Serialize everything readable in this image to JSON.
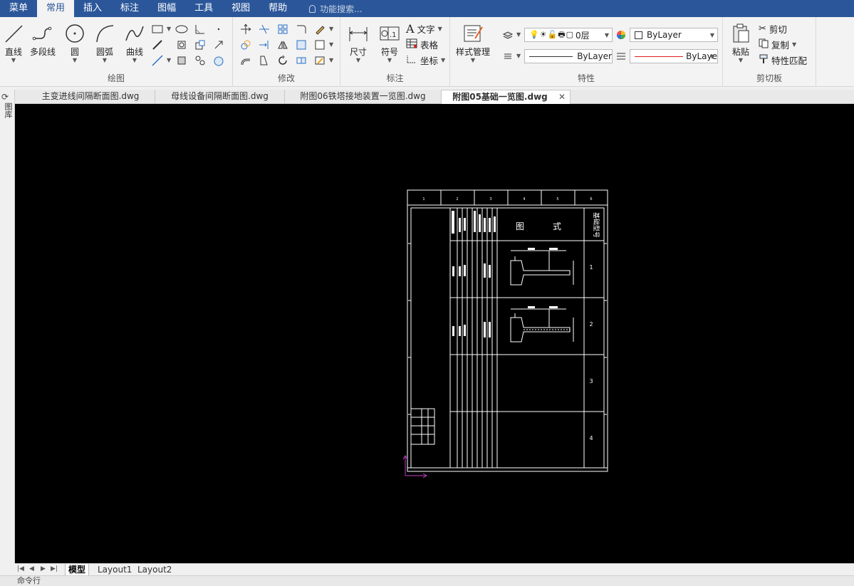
{
  "menu": {
    "items": [
      "菜单",
      "常用",
      "插入",
      "标注",
      "图幅",
      "工具",
      "视图",
      "帮助"
    ],
    "active_index": 1,
    "search_placeholder": "功能搜索..."
  },
  "ribbon": {
    "draw": {
      "label": "绘图",
      "line": "直线",
      "polyline": "多段线",
      "circle": "圆",
      "arc": "圆弧",
      "spline": "曲线"
    },
    "modify": {
      "label": "修改"
    },
    "annotate": {
      "label": "标注",
      "dimension": "尺寸",
      "symbol": "符号",
      "text": "文字",
      "table": "表格",
      "coord": "坐标"
    },
    "properties": {
      "label": "特性",
      "style_manager": "样式管理",
      "layer_value": "0层",
      "color_value": "ByLayer",
      "linetype_value": "ByLayer",
      "lineweight_value": "ByLaye",
      "accent_color": "#e02020"
    },
    "clipboard": {
      "label": "剪切板",
      "paste": "粘贴",
      "cut": "剪切",
      "copy": "复制",
      "match": "特性匹配"
    }
  },
  "left_bar": {
    "label": "图库"
  },
  "doc_tabs": [
    {
      "label": "主变进线间隔断面图.dwg",
      "active": false
    },
    {
      "label": "母线设备间隔断面图.dwg",
      "active": false
    },
    {
      "label": "附图06铁塔接地装置一览图.dwg",
      "active": false
    },
    {
      "label": "附图05基础一览图.dwg",
      "active": true
    }
  ],
  "layout_tabs": [
    "模型",
    "Layout1",
    "Layout2"
  ],
  "drawing": {
    "header_cells": [
      "1",
      "2",
      "3",
      "4",
      "5",
      "6"
    ],
    "column_titles": [
      "图",
      "式"
    ],
    "side_title": "基础型号",
    "row_numbers": [
      "1",
      "2",
      "3",
      "4"
    ],
    "ucs_color": "#c040c0"
  },
  "command_prompt": "命令行"
}
